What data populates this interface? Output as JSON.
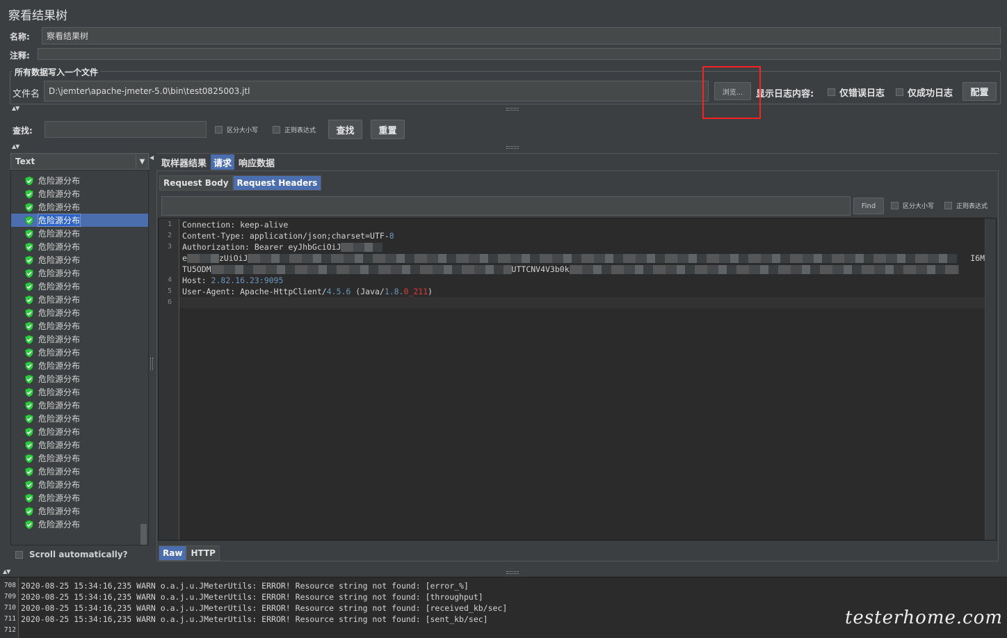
{
  "title": "察看结果树",
  "name_field": {
    "label": "名称:",
    "value": "察看结果树"
  },
  "comment_field": {
    "label": "注释:",
    "value": ""
  },
  "file_group": {
    "title": "所有数据写入一个文件",
    "file_label": "文件名",
    "file_value": "D:\\jemter\\apache-jmeter-5.0\\bin\\test0825003.jtl",
    "browse_label": "浏览...",
    "log_label": "显示日志内容:",
    "errors_only": "仅错误日志",
    "success_only": "仅成功日志",
    "config_label": "配置"
  },
  "search": {
    "label": "查找:",
    "value": "",
    "case_label": "区分大小写",
    "regex_label": "正则表达式",
    "find_label": "查找",
    "reset_label": "重置"
  },
  "renderer": {
    "selected": "Text"
  },
  "tree": {
    "item_label": "危险源分布",
    "items": [
      "危险源分布",
      "危险源分布",
      "危险源分布",
      "危险源分布",
      "危险源分布",
      "危险源分布",
      "危险源分布",
      "危险源分布",
      "危险源分布",
      "危险源分布",
      "危险源分布",
      "危险源分布",
      "危险源分布",
      "危险源分布",
      "危险源分布",
      "危险源分布",
      "危险源分布",
      "危险源分布",
      "危险源分布",
      "危险源分布",
      "危险源分布",
      "危险源分布",
      "危险源分布",
      "危险源分布",
      "危险源分布",
      "危险源分布",
      "危险源分布"
    ],
    "selected_index": 3,
    "scroll_auto": "Scroll automatically?"
  },
  "tabs": {
    "sampler": "取样器结果",
    "request": "请求",
    "response": "响应数据"
  },
  "subtabs": {
    "body": "Request Body",
    "headers": "Request Headers"
  },
  "find_bar": {
    "value": "",
    "find_label": "Find",
    "case_label": "区分大小写",
    "regex_label": "正则表达式"
  },
  "editor": {
    "line_numbers": [
      "1",
      "2",
      "3",
      "",
      "",
      "4",
      "5",
      "6"
    ],
    "l1": "Connection: keep-alive",
    "l2a": "Content-Type: application/json;charset=UTF-",
    "l2b": "8",
    "l3": "Authorization: Bearer eyJhbGciOiJ",
    "l3b": "e",
    "l3c": "zUiOiJ",
    "l3tail": "I6M",
    "l3d": "TU5ODM",
    "l3e": "UTTCNV4V3b0k",
    "l4a": "Host: ",
    "l4b": "2.82.16.23:9095",
    "l5a": "User-Agent: Apache-HttpClient/",
    "l5b": "4.5.6",
    "l5c": " (Java/",
    "l5d": "1.8.",
    "l5e": "0_211",
    "l5f": ")"
  },
  "bottom_tabs": {
    "raw": "Raw",
    "http": "HTTP"
  },
  "log": {
    "line_numbers": [
      "708",
      "709",
      "710",
      "711",
      "712"
    ],
    "lines": [
      "2020-08-25 15:34:16,235 WARN o.a.j.u.JMeterUtils: ERROR! Resource string not found: [error_%]",
      "2020-08-25 15:34:16,235 WARN o.a.j.u.JMeterUtils: ERROR! Resource string not found: [throughput]",
      "2020-08-25 15:34:16,235 WARN o.a.j.u.JMeterUtils: ERROR! Resource string not found: [received_kb/sec]",
      "2020-08-25 15:34:16,235 WARN o.a.j.u.JMeterUtils: ERROR! Resource string not found: [sent_kb/sec]",
      ""
    ]
  },
  "watermark": "testerhome.com",
  "colors": {
    "accent": "#4b6eaf",
    "highlight_box": "#ff2020",
    "success_icon": "#2ecc40"
  }
}
